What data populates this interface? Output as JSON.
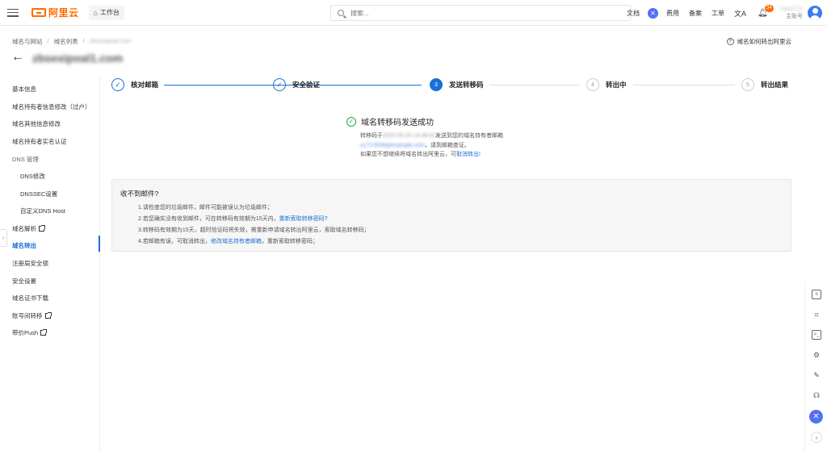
{
  "topbar": {
    "logo_text": "阿里云",
    "workbench_label": "工作台",
    "search_placeholder": "搜索...",
    "links": [
      "文档",
      "费用",
      "备案",
      "工单"
    ],
    "notification_count": "34",
    "account_name": "hao3715",
    "account_role": "主账号",
    "accent_color": "#ff6a00"
  },
  "breadcrumb": [
    "域名与网站",
    "域名列表",
    "zbsexipoal.com"
  ],
  "help_link": "域名如何转出阿里云",
  "domain_title": "zbsexipoal1.com",
  "sidebar": {
    "items": [
      {
        "label": "基本信息",
        "type": "item"
      },
      {
        "label": "域名持有者信息修改（过户）",
        "type": "item"
      },
      {
        "label": "域名其他信息修改",
        "type": "item"
      },
      {
        "label": "域名持有者实名认证",
        "type": "item"
      },
      {
        "label": "DNS 管理",
        "type": "section"
      },
      {
        "label": "DNS修改",
        "type": "sub"
      },
      {
        "label": "DNSSEC设置",
        "type": "sub"
      },
      {
        "label": "自定义DNS Host",
        "type": "sub"
      },
      {
        "label": "域名解析",
        "type": "item",
        "external": true
      },
      {
        "label": "域名转出",
        "type": "item",
        "active": true
      },
      {
        "label": "注册局安全锁",
        "type": "item"
      },
      {
        "label": "安全设置",
        "type": "item"
      },
      {
        "label": "域名证书下载",
        "type": "item"
      },
      {
        "label": "账号间转移",
        "type": "item",
        "external": true
      },
      {
        "label": "带价Push",
        "type": "item",
        "external": true
      }
    ]
  },
  "steps": [
    {
      "label": "核对邮箱",
      "state": "done",
      "num": "1"
    },
    {
      "label": "安全验证",
      "state": "done",
      "num": "2"
    },
    {
      "label": "发送转移码",
      "state": "current",
      "num": "3"
    },
    {
      "label": "转出中",
      "state": "todo",
      "num": "4"
    },
    {
      "label": "转出结果",
      "state": "todo",
      "num": "5"
    }
  ],
  "success": {
    "title": "域名转移码发送成功",
    "line1_prefix": "转移码于",
    "line1_time": "2022-05-25 14:36:02",
    "line1_suffix": "发送到您的域名持有者邮箱",
    "line2_email": "a1713538@example.com",
    "line2_suffix": "，请到邮箱查证。",
    "line3_prefix": "如果您不想继续将域名转出阿里云，可",
    "line3_link": "取消转出!"
  },
  "notice": {
    "title": "收不到邮件?",
    "item1": "1.请检查您的垃圾邮件，邮件可能被误认为垃圾邮件；",
    "item2_prefix": "2.若您确实没有收到邮件，可在转移码有效期为15天内，",
    "item2_link": "重新索取转移密码?",
    "item3": "3.转移码有效期为15天，超时验证码将失效，需重新申请域名转出阿里云，索取域名转移码；",
    "item4_prefix": "4.若邮箱有误，可取消转出，",
    "item4_link": "修改域名持有者邮箱",
    "item4_suffix": "，重新索取转移密码；"
  },
  "rail_icons": [
    "document-icon",
    "crop-icon",
    "terminal-icon",
    "settings-icon",
    "edit-icon",
    "headset-icon",
    "assistant-icon",
    "expand-icon"
  ],
  "colors": {
    "primary": "#1a6fd6",
    "success": "#2aa547"
  }
}
